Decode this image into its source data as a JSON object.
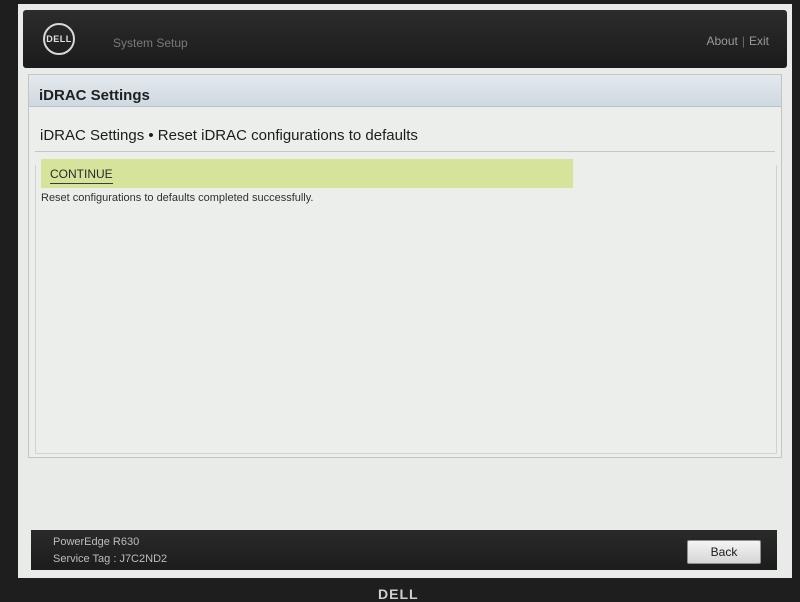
{
  "header": {
    "logo_text": "DELL",
    "app_title": "System Setup",
    "about_label": "About",
    "separator": "|",
    "exit_label": "Exit"
  },
  "section": {
    "title": "iDRAC Settings"
  },
  "page": {
    "title": "iDRAC Settings • Reset iDRAC configurations to defaults",
    "continue_label": "CONTINUE",
    "status_message": "Reset configurations to defaults completed successfully."
  },
  "footer": {
    "model": "PowerEdge R630",
    "service_tag": "Service Tag : J7C2ND2",
    "back_label": "Back"
  },
  "bezel": {
    "logo_text": "DELL"
  },
  "colors": {
    "highlight": "#d6e39a",
    "header_bg": "#1b1b1b",
    "panel_bg": "#eceeec",
    "section_bar": "#cfd9e1"
  }
}
